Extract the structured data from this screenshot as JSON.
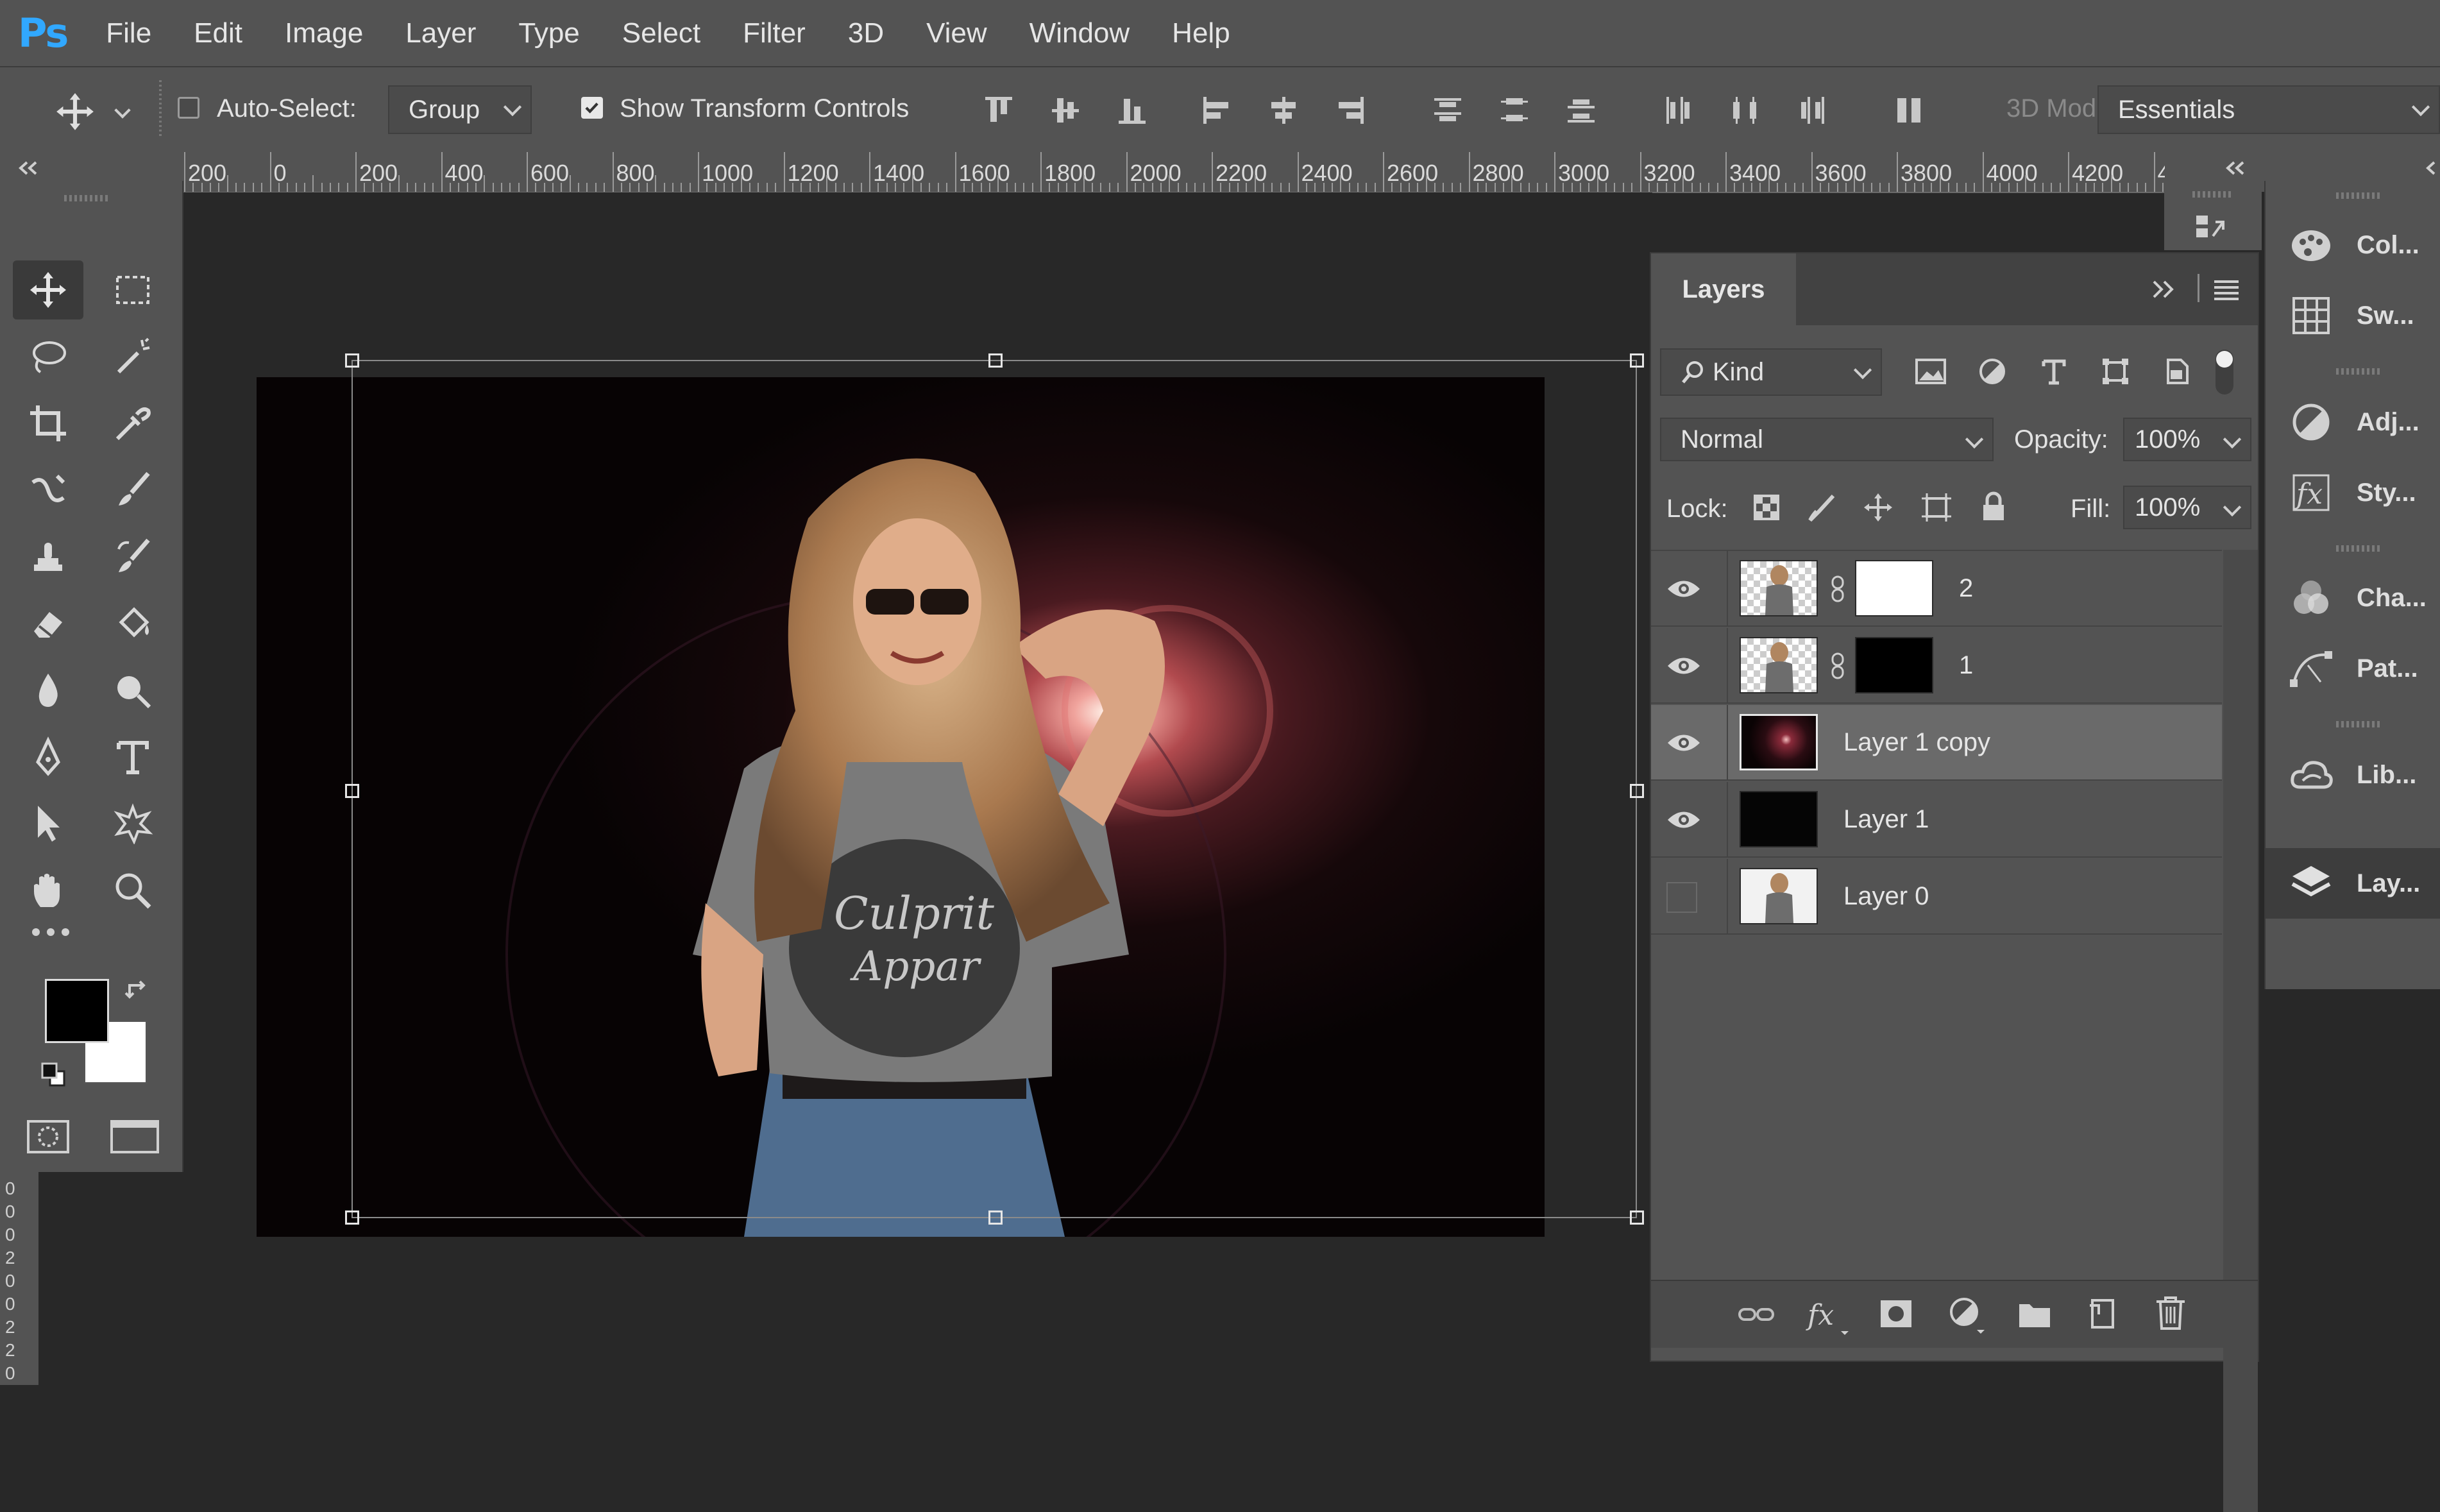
{
  "app": {
    "logo": "Ps"
  },
  "menu": [
    "File",
    "Edit",
    "Image",
    "Layer",
    "Type",
    "Select",
    "Filter",
    "3D",
    "View",
    "Window",
    "Help"
  ],
  "options_bar": {
    "tool_icon": "move-icon",
    "auto_select_label": "Auto-Select:",
    "auto_select_checked": false,
    "auto_select_target": "Group",
    "show_transform_label": "Show Transform Controls",
    "show_transform_checked": true,
    "mode_3d_label": "3D Mod",
    "workspace": "Essentials"
  },
  "ruler": {
    "labels": [
      "200",
      "0",
      "200",
      "400",
      "600",
      "800",
      "1000",
      "1200",
      "1400",
      "1600",
      "1800",
      "2000",
      "2200",
      "2400",
      "2600",
      "2800",
      "3000",
      "3200",
      "3400",
      "3600",
      "3800",
      "4000",
      "4200",
      "4"
    ]
  },
  "vertical_ruler": {
    "labels": [
      "0",
      "0",
      "0",
      "2",
      "0",
      "0",
      "2",
      "2",
      "0"
    ]
  },
  "tools": [
    "move-tool",
    "marquee-tool",
    "lasso-tool",
    "magic-wand-tool",
    "crop-tool",
    "eyedropper-tool",
    "healing-tool",
    "brush-tool",
    "stamp-tool",
    "history-brush-tool",
    "eraser-tool",
    "paint-bucket-tool",
    "blur-tool",
    "dodge-tool",
    "pen-tool",
    "type-tool",
    "path-select-tool",
    "custom-shape-tool",
    "hand-tool",
    "zoom-tool"
  ],
  "colors": {
    "foreground": "#000000",
    "background": "#ffffff",
    "accent": "#31a8ff"
  },
  "layers_panel": {
    "title": "Layers",
    "filter_kind": "Kind",
    "blend_mode": "Normal",
    "opacity_label": "Opacity:",
    "opacity": "100%",
    "lock_label": "Lock:",
    "fill_label": "Fill:",
    "fill": "100%",
    "layers": [
      {
        "name": "2",
        "visible": true,
        "has_mask": true,
        "mask_color": "#ffffff",
        "selected": false
      },
      {
        "name": "1",
        "visible": true,
        "has_mask": true,
        "mask_color": "#000000",
        "selected": false
      },
      {
        "name": "Layer 1 copy",
        "visible": true,
        "has_mask": false,
        "selected": true
      },
      {
        "name": "Layer 1",
        "visible": true,
        "has_mask": false,
        "selected": false
      },
      {
        "name": "Layer 0",
        "visible": false,
        "has_mask": false,
        "selected": false
      }
    ]
  },
  "side_panels": [
    "Col...",
    "Sw...",
    "Adj...",
    "Sty...",
    "Cha...",
    "Pat...",
    "Lib...",
    "Lay..."
  ],
  "canvas_image": {
    "shirt_text_line1": "Culprit",
    "shirt_text_line2": "Appar"
  }
}
